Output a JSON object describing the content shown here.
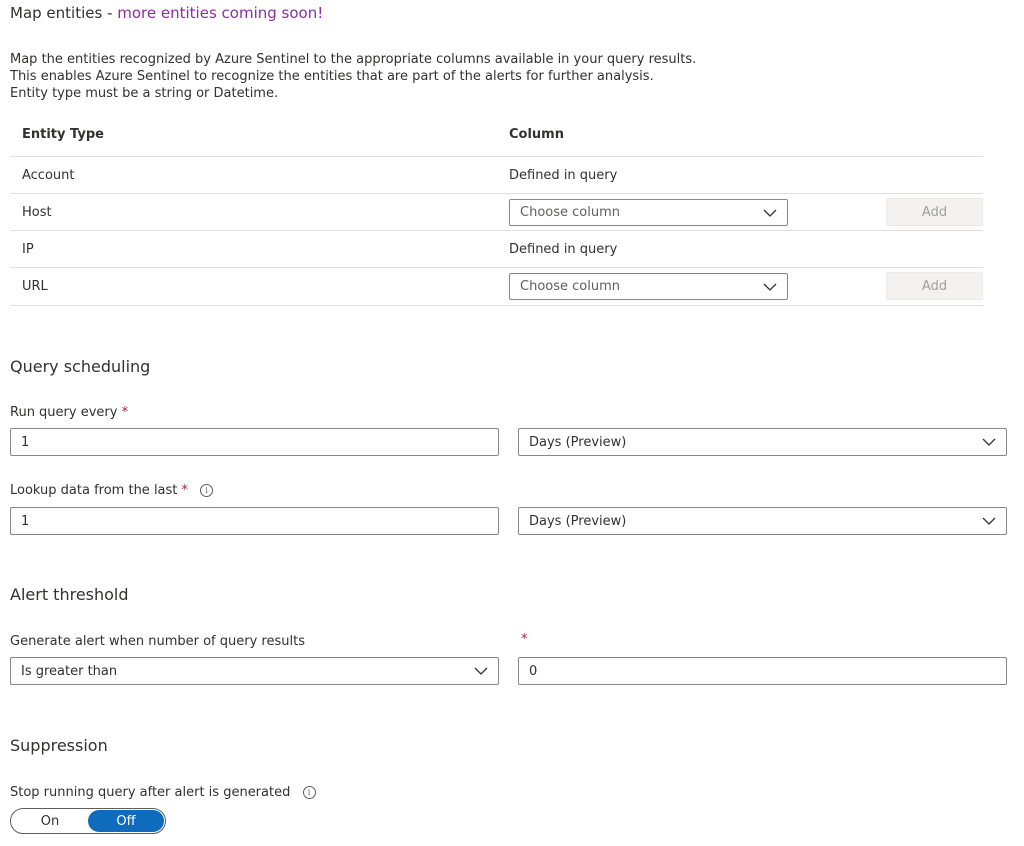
{
  "header": {
    "title": "Map entities -",
    "title_accent": "more entities coming soon!",
    "description": [
      "Map the entities recognized by Azure Sentinel to the appropriate columns available in your query results.",
      "This enables Azure Sentinel to recognize the entities that are part of the alerts for further analysis.",
      "Entity type must be a string or Datetime."
    ]
  },
  "entity_table": {
    "columns": [
      "Entity Type",
      "Column"
    ],
    "rows": [
      {
        "entity": "Account",
        "column_text": "Defined in query"
      },
      {
        "entity": "Host",
        "placeholder": "Choose column",
        "add_label": "Add"
      },
      {
        "entity": "IP",
        "column_text": "Defined in query"
      },
      {
        "entity": "URL",
        "placeholder": "Choose column",
        "add_label": "Add"
      }
    ]
  },
  "scheduling": {
    "section_title": "Query scheduling",
    "run_every_label": "Run query every",
    "run_every_value": "1",
    "run_every_unit": "Days (Preview)",
    "lookup_label": "Lookup data from the last",
    "lookup_value": "1",
    "lookup_unit": "Days (Preview)",
    "required_mark": "*"
  },
  "threshold": {
    "section_title": "Alert threshold",
    "generate_label": "Generate alert when number of query results",
    "operator": "Is greater than",
    "value": "0",
    "required_mark": "*"
  },
  "suppression": {
    "section_title": "Suppression",
    "stop_label": "Stop running query after alert is generated",
    "on_label": "On",
    "off_label": "Off",
    "selected": "Off"
  },
  "colors": {
    "accent": "#8a2da5",
    "required": "#a4262c",
    "toggle_active": "#0f6cbd"
  },
  "icons": {
    "dropdown": "chevron-down-icon",
    "info": "info-icon"
  }
}
